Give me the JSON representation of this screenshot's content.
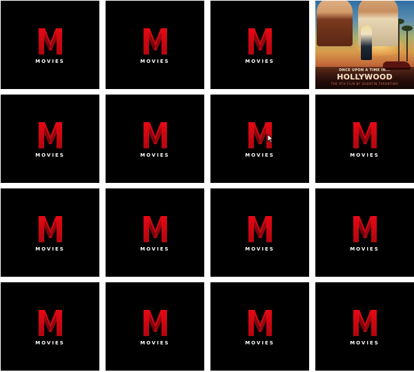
{
  "game": {
    "card_back_logo": "M",
    "card_back_label": "MOVIES",
    "grid": {
      "rows": 4,
      "columns": 4
    },
    "cards": [
      {
        "row": 1,
        "col": 1,
        "state": "face-down"
      },
      {
        "row": 1,
        "col": 2,
        "state": "face-down"
      },
      {
        "row": 1,
        "col": 3,
        "state": "face-down"
      },
      {
        "row": 1,
        "col": 4,
        "state": "face-up",
        "poster": {
          "tagline": "ONCE UPON A TIME IN...",
          "title": "HOLLYWOOD",
          "credit": "THE 9TH FILM BY QUENTIN TARANTINO"
        }
      },
      {
        "row": 2,
        "col": 1,
        "state": "face-down"
      },
      {
        "row": 2,
        "col": 2,
        "state": "face-down"
      },
      {
        "row": 2,
        "col": 3,
        "state": "face-down"
      },
      {
        "row": 2,
        "col": 4,
        "state": "face-down"
      },
      {
        "row": 3,
        "col": 1,
        "state": "face-down"
      },
      {
        "row": 3,
        "col": 2,
        "state": "face-down"
      },
      {
        "row": 3,
        "col": 3,
        "state": "face-down"
      },
      {
        "row": 3,
        "col": 4,
        "state": "face-down"
      },
      {
        "row": 4,
        "col": 1,
        "state": "face-down"
      },
      {
        "row": 4,
        "col": 2,
        "state": "face-down"
      },
      {
        "row": 4,
        "col": 3,
        "state": "face-down"
      },
      {
        "row": 4,
        "col": 4,
        "state": "face-down"
      }
    ]
  },
  "colors": {
    "card_back": "#000000",
    "logo_red": "#e50914",
    "logo_dark_red": "#8a0610",
    "label": "#ffffff",
    "board_gap": "#ffffff"
  },
  "icons": {
    "logo": "m-logo-icon",
    "cursor": "mouse-pointer-icon"
  }
}
